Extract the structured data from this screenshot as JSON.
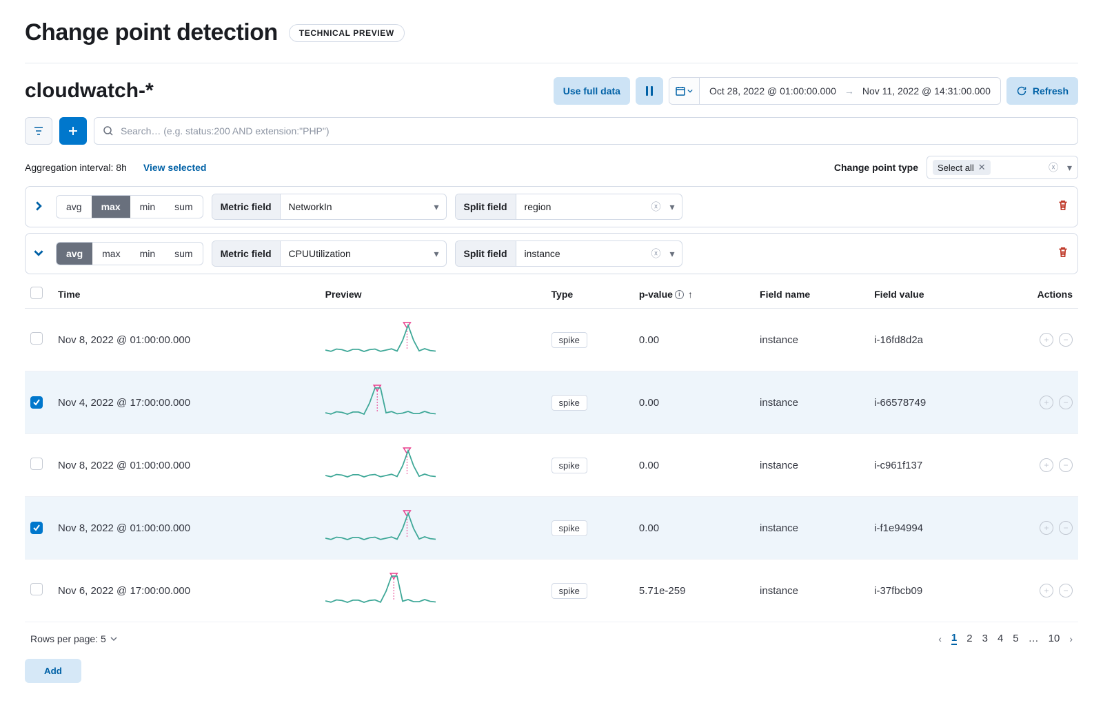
{
  "title": {
    "main": "Change point detection",
    "badge": "TECHNICAL PREVIEW"
  },
  "index_pattern": "cloudwatch-*",
  "toolbar": {
    "use_full_data": "Use full data",
    "refresh": "Refresh",
    "date_start": "Oct 28, 2022 @ 01:00:00.000",
    "date_end": "Nov 11, 2022 @ 14:31:00.000"
  },
  "search": {
    "placeholder": "Search… (e.g. status:200 AND extension:\"PHP\")"
  },
  "meta": {
    "aggregation_interval_label": "Aggregation interval: 8h",
    "view_selected": "View selected",
    "change_point_type_label": "Change point type",
    "type_filter_value": "Select all"
  },
  "configs": [
    {
      "expanded": false,
      "agg_options": [
        "avg",
        "max",
        "min",
        "sum"
      ],
      "agg_selected": "max",
      "metric_field_label": "Metric field",
      "metric_field_value": "NetworkIn",
      "split_field_label": "Split field",
      "split_field_value": "region"
    },
    {
      "expanded": true,
      "agg_options": [
        "avg",
        "max",
        "min",
        "sum"
      ],
      "agg_selected": "avg",
      "metric_field_label": "Metric field",
      "metric_field_value": "CPUUtilization",
      "split_field_label": "Split field",
      "split_field_value": "instance"
    }
  ],
  "table": {
    "headers": {
      "time": "Time",
      "preview": "Preview",
      "type": "Type",
      "pvalue": "p-value",
      "field_name": "Field name",
      "field_value": "Field value",
      "actions": "Actions"
    },
    "rows": [
      {
        "selected": false,
        "time": "Nov 8, 2022 @ 01:00:00.000",
        "type": "spike",
        "pvalue": "0.00",
        "field_name": "instance",
        "field_value": "i-16fd8d2a",
        "spike_at": 0.74
      },
      {
        "selected": true,
        "time": "Nov 4, 2022 @ 17:00:00.000",
        "type": "spike",
        "pvalue": "0.00",
        "field_name": "instance",
        "field_value": "i-66578749",
        "spike_at": 0.47
      },
      {
        "selected": false,
        "time": "Nov 8, 2022 @ 01:00:00.000",
        "type": "spike",
        "pvalue": "0.00",
        "field_name": "instance",
        "field_value": "i-c961f137",
        "spike_at": 0.74
      },
      {
        "selected": true,
        "time": "Nov 8, 2022 @ 01:00:00.000",
        "type": "spike",
        "pvalue": "0.00",
        "field_name": "instance",
        "field_value": "i-f1e94994",
        "spike_at": 0.74
      },
      {
        "selected": false,
        "time": "Nov 6, 2022 @ 17:00:00.000",
        "type": "spike",
        "pvalue": "5.71e-259",
        "field_name": "instance",
        "field_value": "i-37fbcb09",
        "spike_at": 0.62
      }
    ]
  },
  "pager": {
    "rows_per_page_label": "Rows per page: 5",
    "pages": [
      "1",
      "2",
      "3",
      "4",
      "5",
      "…",
      "10"
    ],
    "active": "1"
  },
  "add_button": "Add"
}
